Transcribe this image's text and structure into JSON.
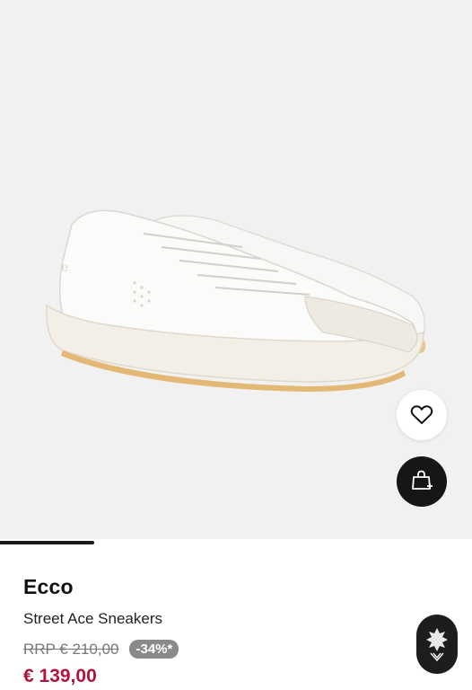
{
  "product": {
    "brand": "Ecco",
    "name": "Street Ace Sneakers",
    "rrp": "RRP € 210,00",
    "discount": "-34%*",
    "price": "€ 139,00"
  },
  "gallery": {
    "image_progress": 0.2,
    "image_subject": "white sneakers pair"
  },
  "actions": {
    "wishlist_icon": "heart-icon",
    "cart_icon": "shopping-bag-plus-icon"
  },
  "colors": {
    "sale_price": "#b3123a",
    "badge_bg": "#8a8a8a",
    "image_bg": "#f1f1f1",
    "cart_button": "#161616"
  }
}
